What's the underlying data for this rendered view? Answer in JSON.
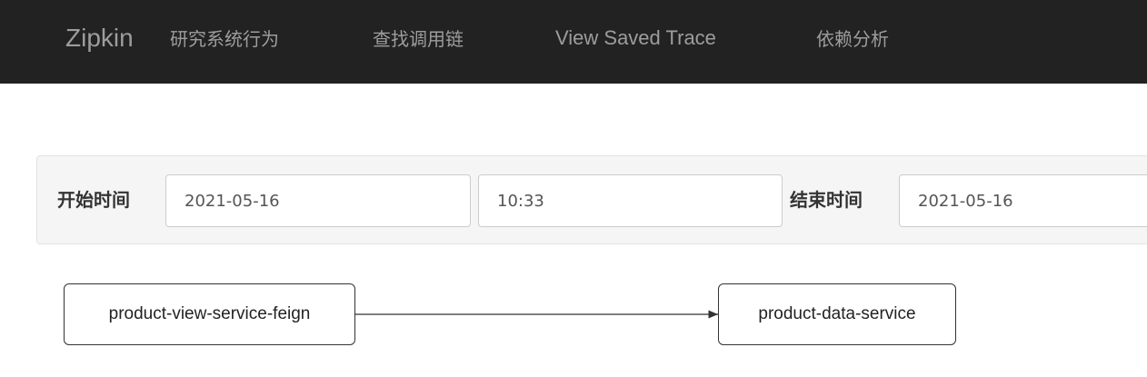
{
  "navbar": {
    "brand": "Zipkin",
    "subtitle": "研究系统行为",
    "links": [
      {
        "label": "查找调用链"
      },
      {
        "label": "View Saved Trace"
      },
      {
        "label": "依赖分析"
      }
    ],
    "background_color": "#222222",
    "text_color": "#9d9d9d"
  },
  "search": {
    "start_label": "开始时间",
    "start_date": "2021-05-16",
    "start_time": "10:33",
    "end_label": "结束时间",
    "end_date": "2021-05-16"
  },
  "dependency_graph": {
    "nodes": [
      {
        "id": "product-view-service-feign",
        "label": "product-view-service-feign"
      },
      {
        "id": "product-data-service",
        "label": "product-data-service"
      }
    ],
    "edges": [
      {
        "from": "product-view-service-feign",
        "to": "product-data-service"
      }
    ]
  }
}
